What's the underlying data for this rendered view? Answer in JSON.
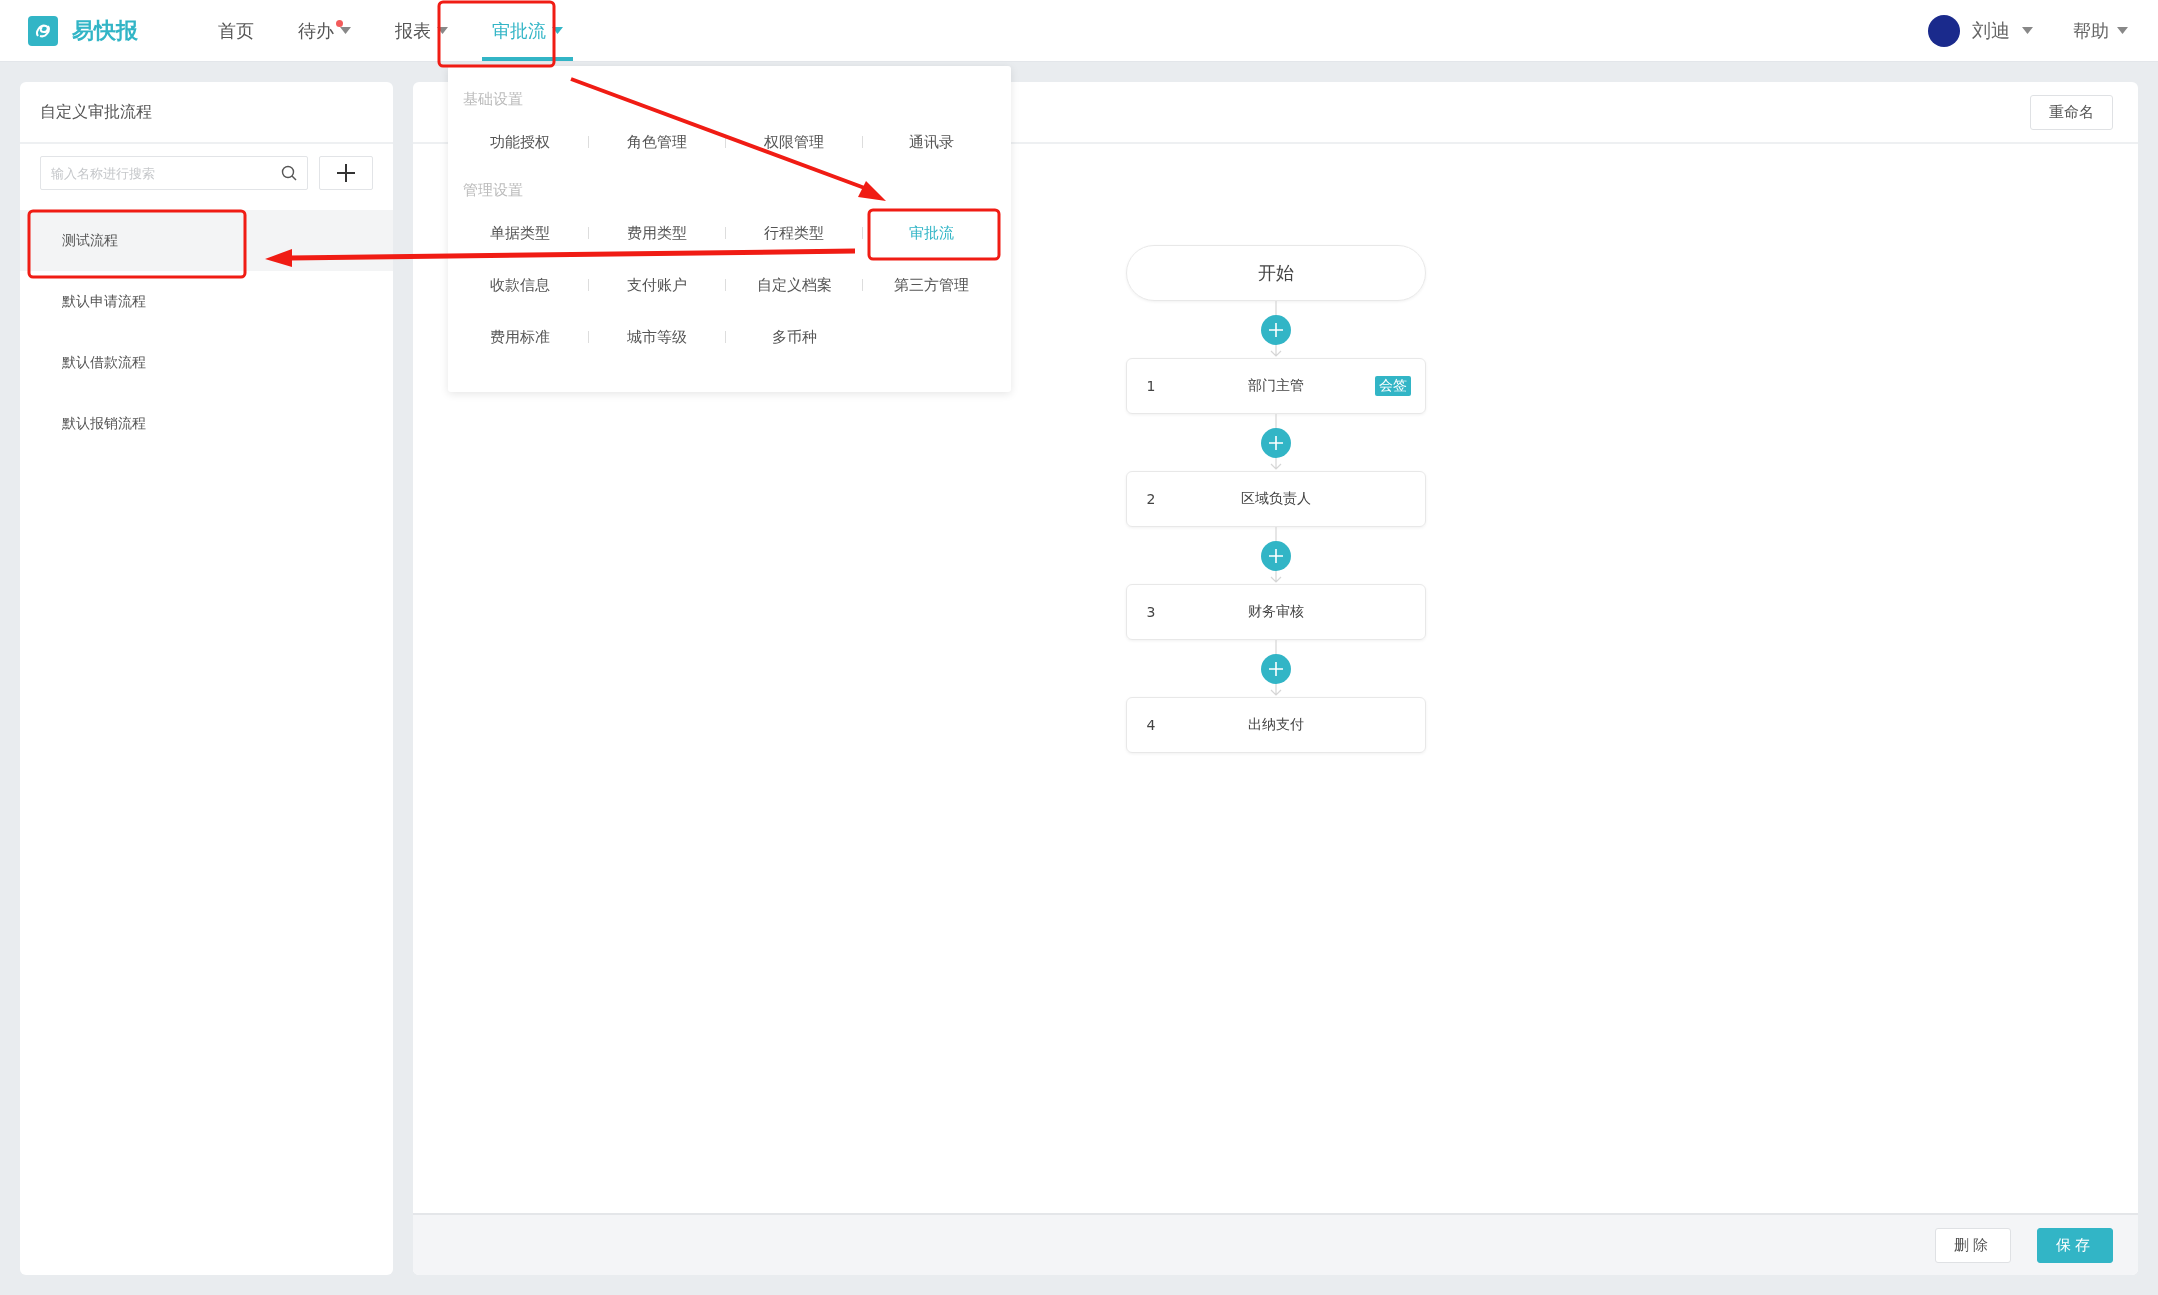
{
  "header": {
    "logo": "易快报",
    "nav": [
      {
        "label": "首页",
        "selected": false,
        "dropdown": false,
        "badge": false
      },
      {
        "label": "待办",
        "selected": false,
        "dropdown": true,
        "badge": true
      },
      {
        "label": "报表",
        "selected": false,
        "dropdown": true,
        "badge": false
      },
      {
        "label": "审批流",
        "selected": true,
        "dropdown": true,
        "badge": false
      }
    ],
    "user": {
      "name": "刘迪"
    },
    "help": "帮助"
  },
  "menu": {
    "groups": [
      {
        "title": "基础设置",
        "items": [
          {
            "label": "功能授权",
            "selected": false
          },
          {
            "label": "角色管理",
            "selected": false
          },
          {
            "label": "权限管理",
            "selected": false
          },
          {
            "label": "通讯录",
            "selected": false
          }
        ]
      },
      {
        "title": "管理设置",
        "items": [
          {
            "label": "单据类型",
            "selected": false
          },
          {
            "label": "费用类型",
            "selected": false
          },
          {
            "label": "行程类型",
            "selected": false
          },
          {
            "label": "审批流",
            "selected": true
          },
          {
            "label": "收款信息",
            "selected": false
          },
          {
            "label": "支付账户",
            "selected": false
          },
          {
            "label": "自定义档案",
            "selected": false
          },
          {
            "label": "第三方管理",
            "selected": false
          },
          {
            "label": "费用标准",
            "selected": false
          },
          {
            "label": "城市等级",
            "selected": false
          },
          {
            "label": "多币种",
            "selected": false
          }
        ]
      }
    ]
  },
  "sidebar": {
    "title": "自定义审批流程",
    "search": {
      "placeholder": "输入名称进行搜索"
    },
    "items": [
      {
        "label": "测试流程",
        "selected": true
      },
      {
        "label": "默认申请流程",
        "selected": false
      },
      {
        "label": "默认借款流程",
        "selected": false
      },
      {
        "label": "默认报销流程",
        "selected": false
      }
    ]
  },
  "main": {
    "rename_button": "重命名",
    "flow": {
      "start": "开始",
      "nodes": [
        {
          "index": "1",
          "name": "部门主管",
          "tag": "会签"
        },
        {
          "index": "2",
          "name": "区域负责人"
        },
        {
          "index": "3",
          "name": "财务审核"
        },
        {
          "index": "4",
          "name": "出纳支付"
        }
      ]
    },
    "buttons": [
      {
        "label": "删除",
        "kind": "default"
      },
      {
        "label": "保存",
        "kind": "primary"
      }
    ]
  }
}
